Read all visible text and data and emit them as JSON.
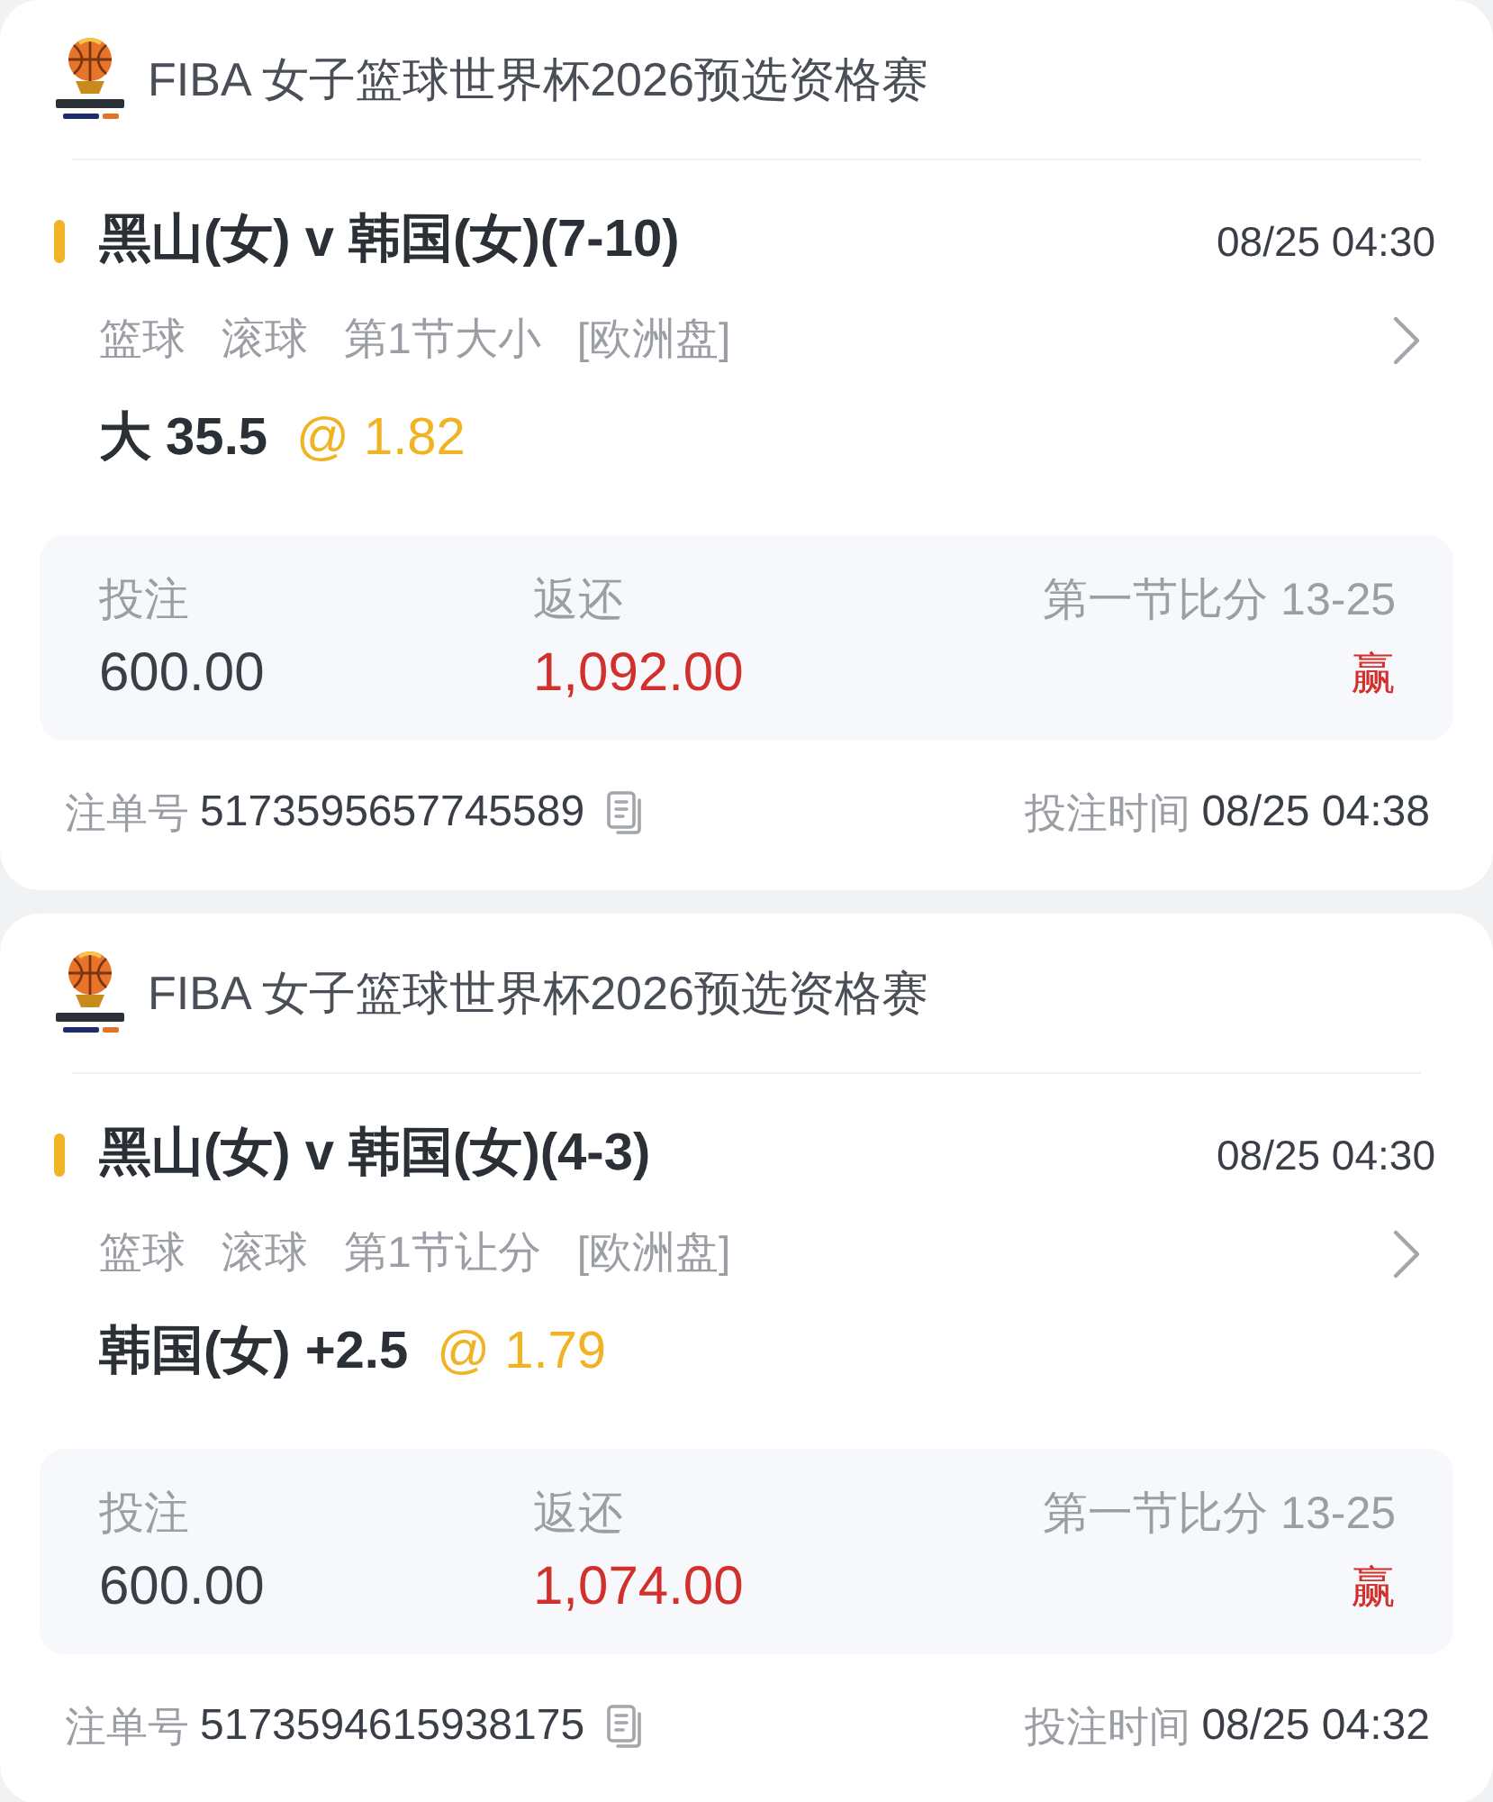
{
  "bets": [
    {
      "league": {
        "title": "FIBA 女子篮球世界杯2026预选资格赛"
      },
      "match": {
        "title": "黑山(女) v 韩国(女)(7-10)",
        "time": "08/25 04:30"
      },
      "tags": [
        "篮球",
        "滚球",
        "第1节大小",
        "[欧洲盘]"
      ],
      "selection": {
        "pick": "大 35.5",
        "odds": "@ 1.82"
      },
      "summary": {
        "stake_label": "投注",
        "stake": "600.00",
        "return_label": "返还",
        "return": "1,092.00",
        "score": "第一节比分 13-25",
        "result": "赢"
      },
      "footer": {
        "ticket_label": "注单号",
        "ticket_no": "5173595657745589",
        "time_label": "投注时间",
        "time": "08/25 04:38"
      }
    },
    {
      "league": {
        "title": "FIBA 女子篮球世界杯2026预选资格赛"
      },
      "match": {
        "title": "黑山(女) v 韩国(女)(4-3)",
        "time": "08/25 04:30"
      },
      "tags": [
        "篮球",
        "滚球",
        "第1节让分",
        "[欧洲盘]"
      ],
      "selection": {
        "pick": "韩国(女) +2.5",
        "odds": "@ 1.79"
      },
      "summary": {
        "stake_label": "投注",
        "stake": "600.00",
        "return_label": "返还",
        "return": "1,074.00",
        "score": "第一节比分 13-25",
        "result": "赢"
      },
      "footer": {
        "ticket_label": "注单号",
        "ticket_no": "5173594615938175",
        "time_label": "投注时间",
        "time": "08/25 04:32"
      }
    }
  ]
}
